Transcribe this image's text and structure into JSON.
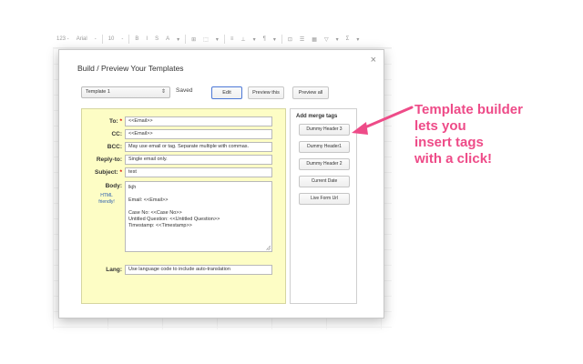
{
  "spreadsheet": {
    "toolbar": [
      "123 -",
      "Arial",
      "-",
      "10",
      "-",
      "B",
      "I",
      "S",
      "A",
      "▾",
      "⊞",
      "⬚",
      "▾",
      "≡",
      "⊥",
      "▾",
      "¶",
      "▾",
      "⊡",
      "☰",
      "▦",
      "▽",
      "▾",
      "Σ",
      "▾"
    ]
  },
  "dialog": {
    "title": "Build / Preview Your Templates",
    "close": "×",
    "template_select": {
      "value": "Template 1",
      "caret": "⇕"
    },
    "saved_text": "Saved",
    "buttons": {
      "edit": "Edit",
      "preview_this": "Preview this",
      "preview_all": "Preview all"
    },
    "fields": {
      "to": {
        "label": "To:",
        "required": "*",
        "value": "<<Email>>"
      },
      "cc": {
        "label": "CC:",
        "value": "<<Email>>"
      },
      "bcc": {
        "label": "BCC:",
        "value": "May use email or tag. Separate multiple with commas."
      },
      "reply_to": {
        "label": "Reply-to:",
        "value": "Single email only."
      },
      "subject": {
        "label": "Subject:",
        "required": "*",
        "value": "test"
      },
      "body": {
        "label": "Body:",
        "html_note": [
          "HTML",
          "friendly!"
        ],
        "lines": [
          "lkjh",
          "",
          "Email: <<Email>>",
          "",
          "Case No: <<Case No>>",
          "Untitled Question: <<Untitled Question>>",
          "Timestamp: <<Timestamp>>"
        ]
      },
      "lang": {
        "label": "Lang:",
        "value": "Use language code to include auto-translation"
      }
    },
    "merge_tags": {
      "title": "Add merge tags",
      "items": [
        "Dummy Header 3",
        "Dummy Header1",
        "Dummy Header 2",
        "Current Date",
        "Live Form Url"
      ]
    }
  },
  "annotation": {
    "lines": [
      "Template builder",
      "lets you",
      "insert tags",
      "with a click!"
    ],
    "color": "#ee4b88"
  }
}
